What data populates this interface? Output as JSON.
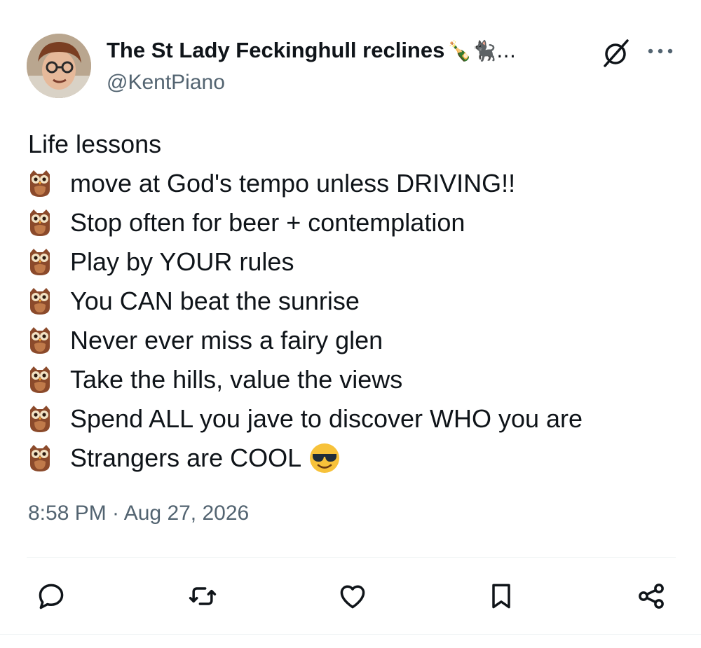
{
  "author": {
    "display_name": "The St Lady Feckinghull reclines",
    "name_emojis": "🍾🐈‍⬛…",
    "handle": "@KentPiano"
  },
  "icons": {
    "grok": "grok-icon",
    "more": "more-options-icon",
    "bullet": "owl-icon",
    "cool": "sunglasses-face-icon",
    "reply": "reply-icon",
    "repost": "repost-icon",
    "like": "like-icon",
    "bookmark": "bookmark-icon",
    "share": "share-icon"
  },
  "tweet": {
    "intro": "Life lessons",
    "items": [
      "move at God's tempo unless DRIVING!!",
      "Stop often for beer + contemplation",
      "Play by YOUR rules",
      "You CAN beat the sunrise",
      "Never ever miss a fairy glen",
      "Take the hills, value the views",
      "Spend ALL you jave to discover WHO you are",
      "Strangers are COOL"
    ],
    "timestamp": "8:58 PM · Aug 27, 2026"
  },
  "colors": {
    "text": "#0f1419",
    "secondary": "#536471",
    "divider": "#eff3f4",
    "owl_brown": "#8b4a2b",
    "emoji_yellow": "#f7c23a"
  }
}
